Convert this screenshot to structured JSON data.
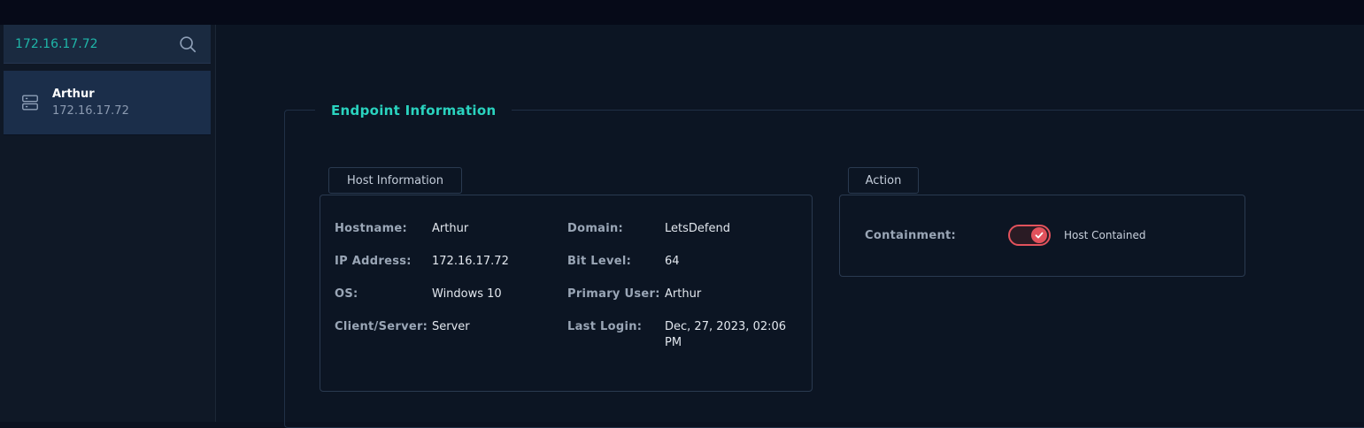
{
  "search": {
    "value": "172.16.17.72"
  },
  "hosts": [
    {
      "name": "Arthur",
      "ip": "172.16.17.72"
    }
  ],
  "endpoint": {
    "title": "Endpoint Information",
    "host_info": {
      "tab": "Host Information",
      "fields": [
        {
          "label": "Hostname:",
          "value": "Arthur"
        },
        {
          "label": "IP Address:",
          "value": "172.16.17.72"
        },
        {
          "label": "OS:",
          "value": "Windows 10"
        },
        {
          "label": "Client/Server:",
          "value": "Server"
        },
        {
          "label": "Domain:",
          "value": "LetsDefend"
        },
        {
          "label": "Bit Level:",
          "value": "64"
        },
        {
          "label": "Primary User:",
          "value": "Arthur"
        },
        {
          "label": "Last Login:",
          "value": "Dec, 27, 2023, 02:06 PM"
        }
      ]
    },
    "action": {
      "tab": "Action",
      "containment_label": "Containment:",
      "toggle_on": true,
      "toggle_text": "Host Contained"
    }
  },
  "colors": {
    "accent": "#2ad3bf",
    "search_text": "#1fb5a8",
    "toggle": "#e2525c"
  }
}
